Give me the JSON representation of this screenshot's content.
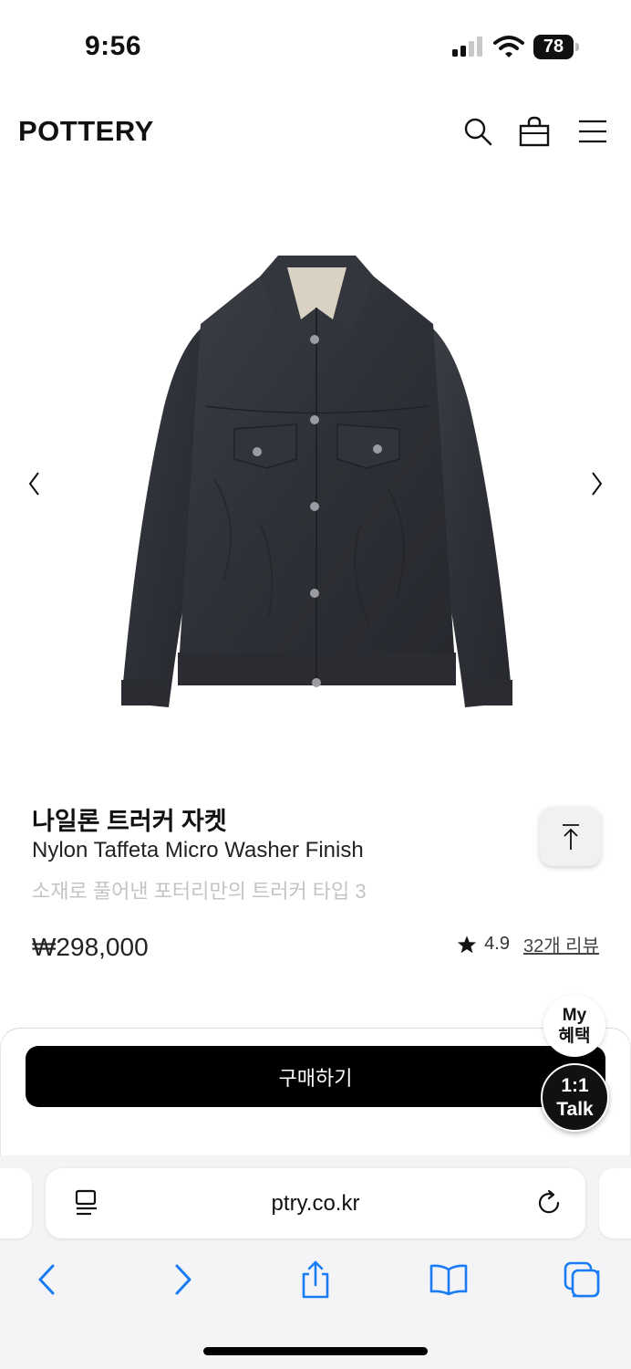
{
  "status_bar": {
    "time": "9:56",
    "battery": "78"
  },
  "header": {
    "logo": "POTTERY"
  },
  "product": {
    "name_ko": "나일론 트러커 자켓",
    "name_en": "Nylon Taffeta Micro Washer Finish",
    "subtitle": "소재로 풀어낸 포터리만의 트러커 타입 3",
    "price": "₩298,000",
    "rating": "4.9",
    "reviews": "32개 리뷰"
  },
  "buttons": {
    "buy": "구매하기",
    "my_benefit_line1": "My",
    "my_benefit_line2": "혜택",
    "talk_line1": "1:1",
    "talk_line2": "Talk"
  },
  "browser": {
    "url": "ptry.co.kr"
  },
  "colors": {
    "primary": "#000000",
    "browser_accent": "#1a7cf5",
    "subtitle": "#c4c4c4"
  },
  "icons": [
    "search-icon",
    "bag-icon",
    "menu-icon",
    "chevron-left-icon",
    "chevron-right-icon",
    "scroll-top-icon",
    "star-icon",
    "reader-icon",
    "reload-icon",
    "back-icon",
    "forward-icon",
    "share-icon",
    "bookmarks-icon",
    "tabs-icon"
  ]
}
